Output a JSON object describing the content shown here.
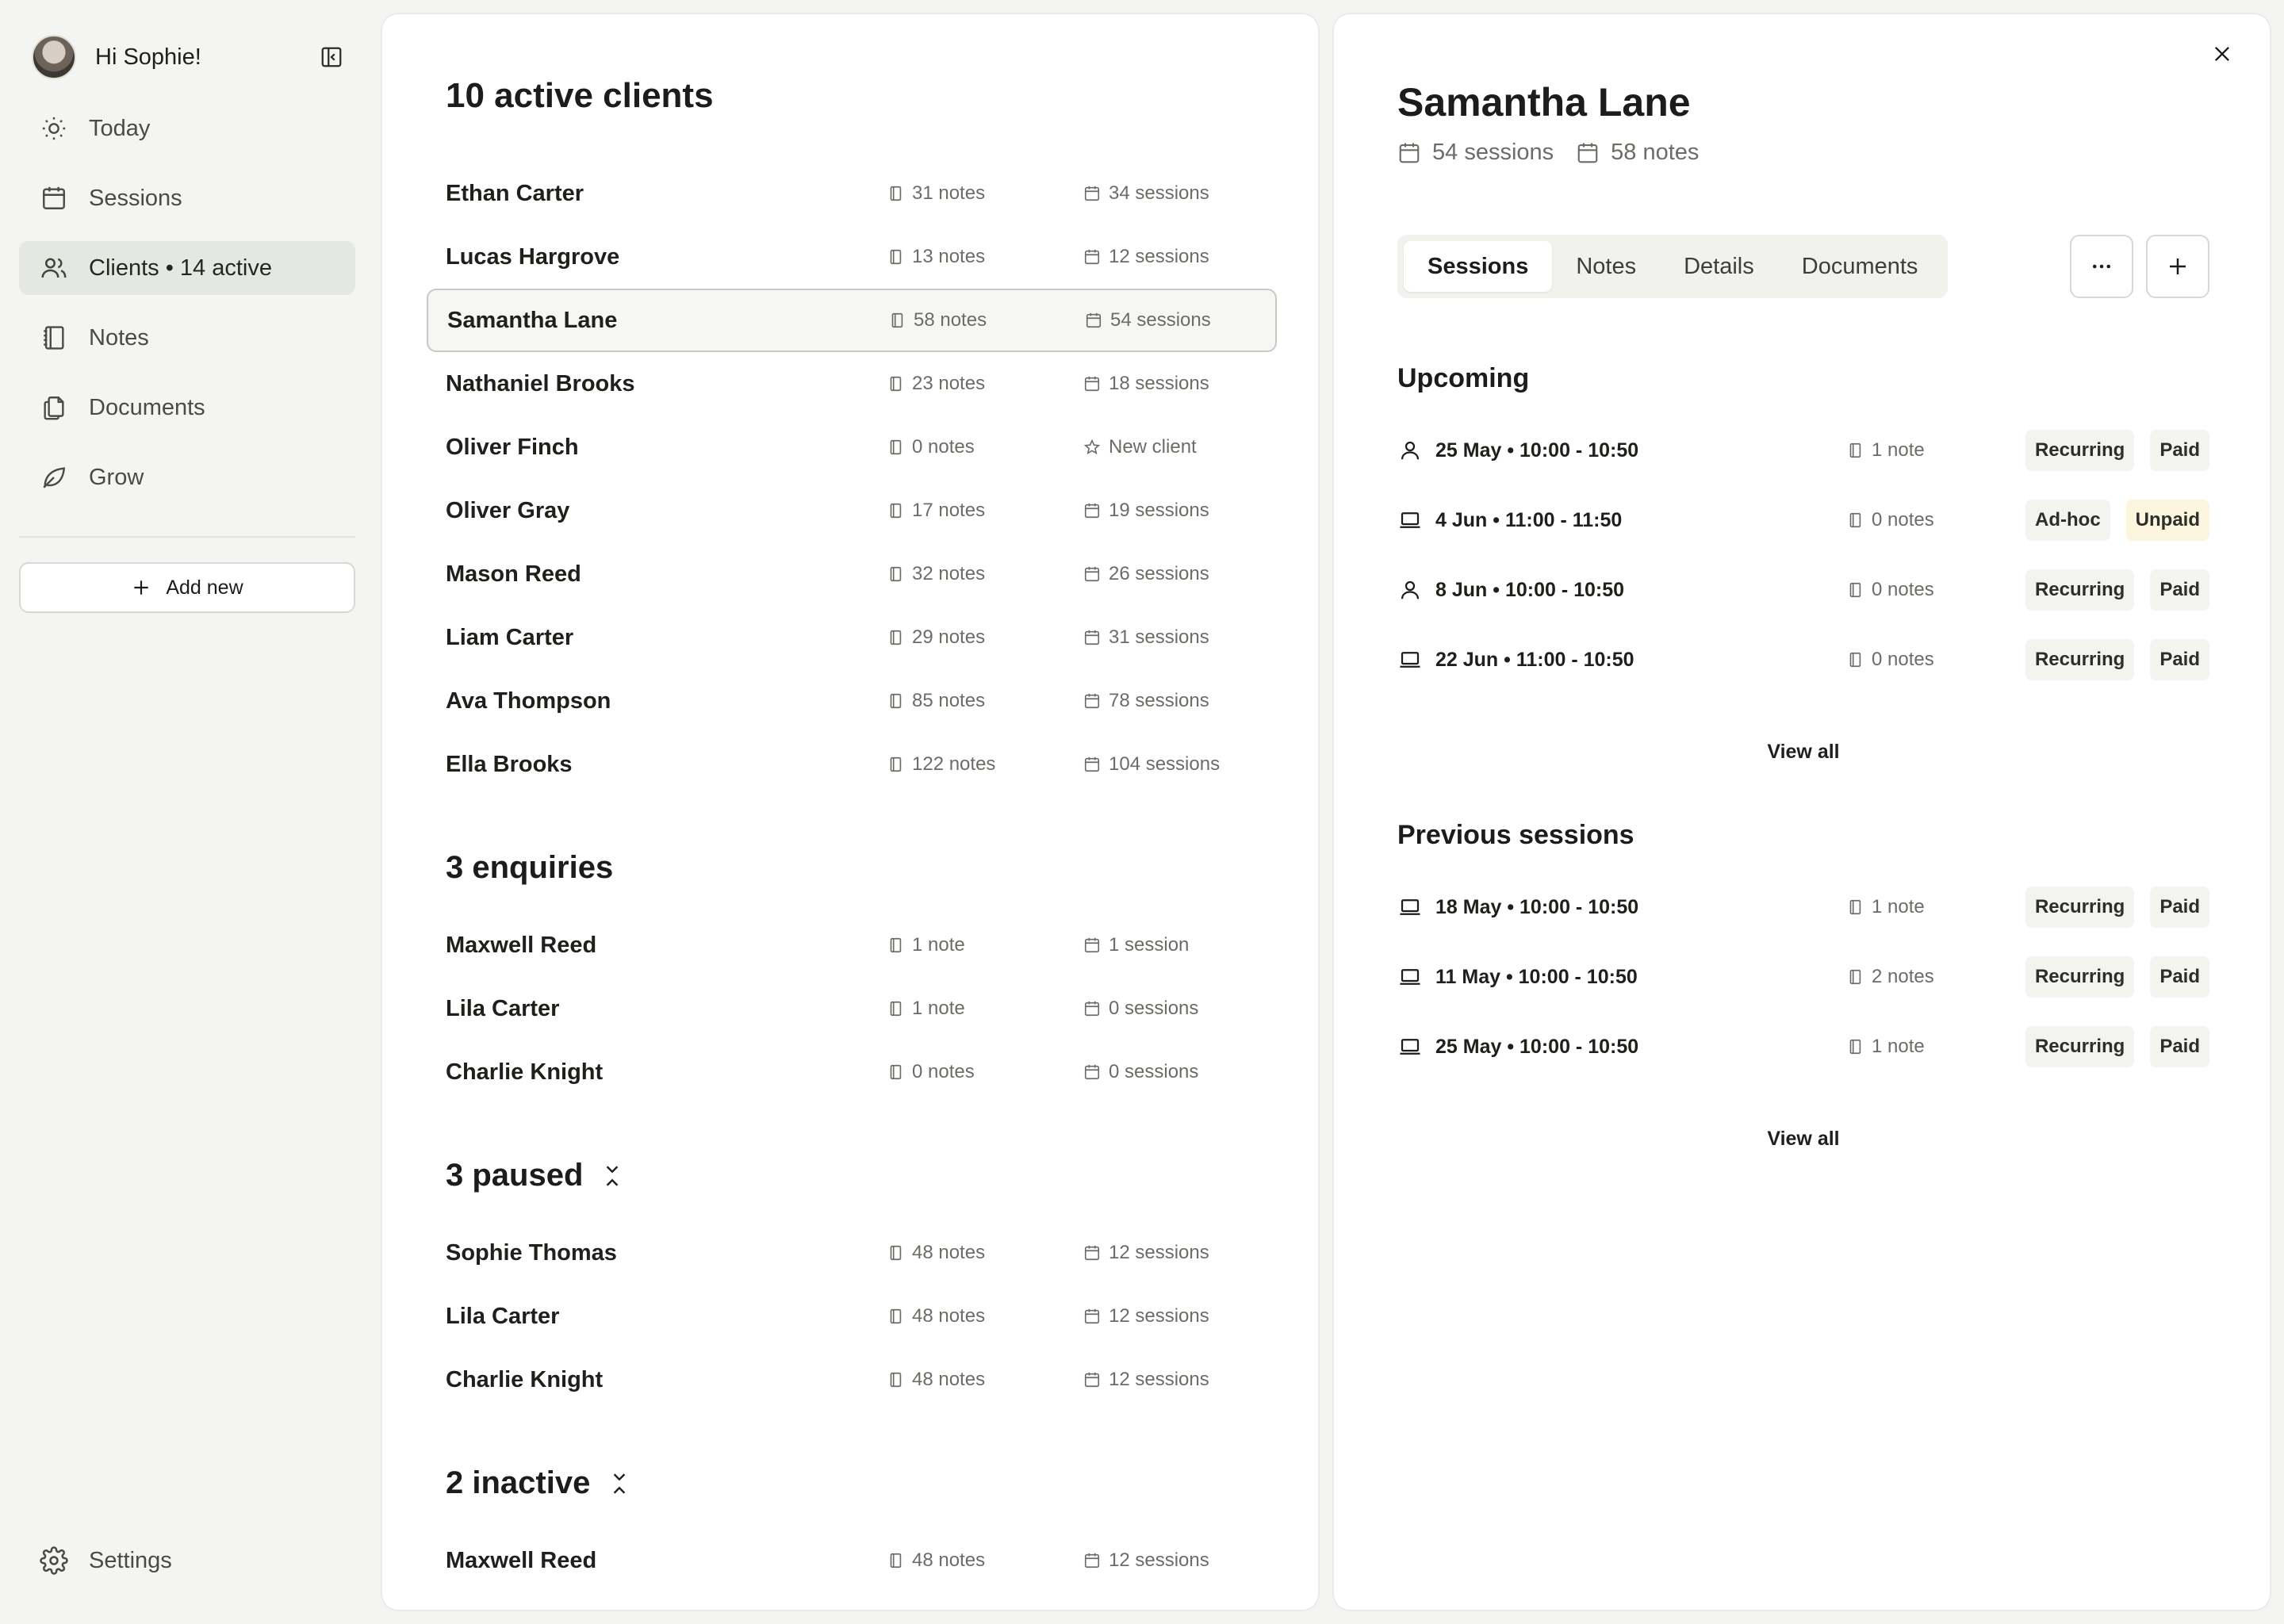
{
  "sidebar": {
    "greeting": "Hi Sophie!",
    "nav": [
      {
        "label": "Today",
        "icon": "sun-icon"
      },
      {
        "label": "Sessions",
        "icon": "calendar-icon"
      },
      {
        "label": "Clients • 14 active",
        "icon": "users-icon"
      },
      {
        "label": "Notes",
        "icon": "notebook-icon"
      },
      {
        "label": "Documents",
        "icon": "documents-icon"
      },
      {
        "label": "Grow",
        "icon": "leaf-icon"
      }
    ],
    "add_new_label": "Add new",
    "settings_label": "Settings"
  },
  "client_list": {
    "active": {
      "title": "10 active clients",
      "rows": [
        {
          "name": "Ethan Carter",
          "notes": "31 notes",
          "sessions": "34 sessions"
        },
        {
          "name": "Lucas Hargrove",
          "notes": "13 notes",
          "sessions": "12 sessions"
        },
        {
          "name": "Samantha Lane",
          "notes": "58 notes",
          "sessions": "54 sessions"
        },
        {
          "name": "Nathaniel Brooks",
          "notes": "23 notes",
          "sessions": "18 sessions"
        },
        {
          "name": "Oliver Finch",
          "notes": "0 notes",
          "sessions": "New client"
        },
        {
          "name": "Oliver Gray",
          "notes": "17 notes",
          "sessions": "19 sessions"
        },
        {
          "name": "Mason Reed",
          "notes": "32 notes",
          "sessions": "26 sessions"
        },
        {
          "name": "Liam Carter",
          "notes": "29 notes",
          "sessions": "31 sessions"
        },
        {
          "name": "Ava Thompson",
          "notes": "85 notes",
          "sessions": "78 sessions"
        },
        {
          "name": "Ella Brooks",
          "notes": "122 notes",
          "sessions": "104 sessions"
        }
      ]
    },
    "enquiries": {
      "title": "3 enquiries",
      "rows": [
        {
          "name": "Maxwell Reed",
          "notes": "1 note",
          "sessions": "1 session"
        },
        {
          "name": "Lila Carter",
          "notes": "1 note",
          "sessions": "0 sessions"
        },
        {
          "name": "Charlie Knight",
          "notes": "0 notes",
          "sessions": "0 sessions"
        }
      ]
    },
    "paused": {
      "title": "3 paused",
      "rows": [
        {
          "name": "Sophie Thomas",
          "notes": "48 notes",
          "sessions": "12 sessions"
        },
        {
          "name": "Lila Carter",
          "notes": "48 notes",
          "sessions": "12 sessions"
        },
        {
          "name": "Charlie Knight",
          "notes": "48 notes",
          "sessions": "12 sessions"
        }
      ]
    },
    "inactive": {
      "title": "2 inactive",
      "rows": [
        {
          "name": "Maxwell Reed",
          "notes": "48 notes",
          "sessions": "12 sessions"
        }
      ]
    }
  },
  "detail": {
    "name": "Samantha Lane",
    "sessions_count": "54 sessions",
    "notes_count": "58 notes",
    "tabs": [
      "Sessions",
      "Notes",
      "Details",
      "Documents"
    ],
    "upcoming": {
      "title": "Upcoming",
      "rows": [
        {
          "when": "25 May • 10:00 - 10:50",
          "mode": "in-person",
          "notes": "1 note",
          "type": "Recurring",
          "payment": "Paid"
        },
        {
          "when": "4 Jun • 11:00 - 11:50",
          "mode": "online",
          "notes": "0 notes",
          "type": "Ad-hoc",
          "payment": "Unpaid"
        },
        {
          "when": "8 Jun • 10:00 - 10:50",
          "mode": "in-person",
          "notes": "0 notes",
          "type": "Recurring",
          "payment": "Paid"
        },
        {
          "when": "22 Jun • 11:00 - 10:50",
          "mode": "online",
          "notes": "0 notes",
          "type": "Recurring",
          "payment": "Paid"
        }
      ],
      "view_all": "View all"
    },
    "previous": {
      "title": "Previous sessions",
      "rows": [
        {
          "when": "18 May • 10:00 - 10:50",
          "mode": "online",
          "notes": "1 note",
          "type": "Recurring",
          "payment": "Paid"
        },
        {
          "when": "11 May • 10:00 - 10:50",
          "mode": "online",
          "notes": "2 notes",
          "type": "Recurring",
          "payment": "Paid"
        },
        {
          "when": "25 May • 10:00 - 10:50",
          "mode": "online",
          "notes": "1 note",
          "type": "Recurring",
          "payment": "Paid"
        }
      ],
      "view_all": "View all"
    }
  },
  "colors": {
    "accent_active_bg": "#e5e8e2",
    "unpaid_bg": "#fcf6df",
    "badge_bg": "#f3f3f0"
  }
}
